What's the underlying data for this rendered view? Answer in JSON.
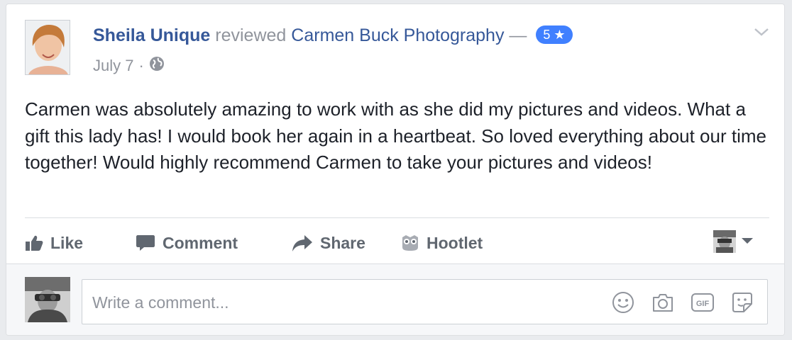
{
  "post": {
    "author": "Sheila Unique",
    "action": "reviewed",
    "page": "Carmen Buck Photography",
    "dash": "—",
    "rating": "5 ★",
    "date": "July 7",
    "separator": "·",
    "audience_icon": "globe-icon",
    "menu_icon": "chevron-down-icon",
    "text": "Carmen was absolutely amazing to work with as she did my pictures and videos. What a gift this lady has! I would book her again in a heartbeat. So loved everything about our time together! Would highly recommend Carmen to take your pictures and videos!"
  },
  "actions": {
    "like": "Like",
    "comment": "Comment",
    "share": "Share",
    "hootlet": "Hootlet"
  },
  "comment_box": {
    "placeholder": "Write a comment...",
    "icons": [
      "smiley-icon",
      "camera-icon",
      "gif-icon",
      "sticker-icon"
    ]
  },
  "colors": {
    "link": "#365899",
    "badge": "#4080ff",
    "muted": "#90949c",
    "text": "#1d2129"
  }
}
